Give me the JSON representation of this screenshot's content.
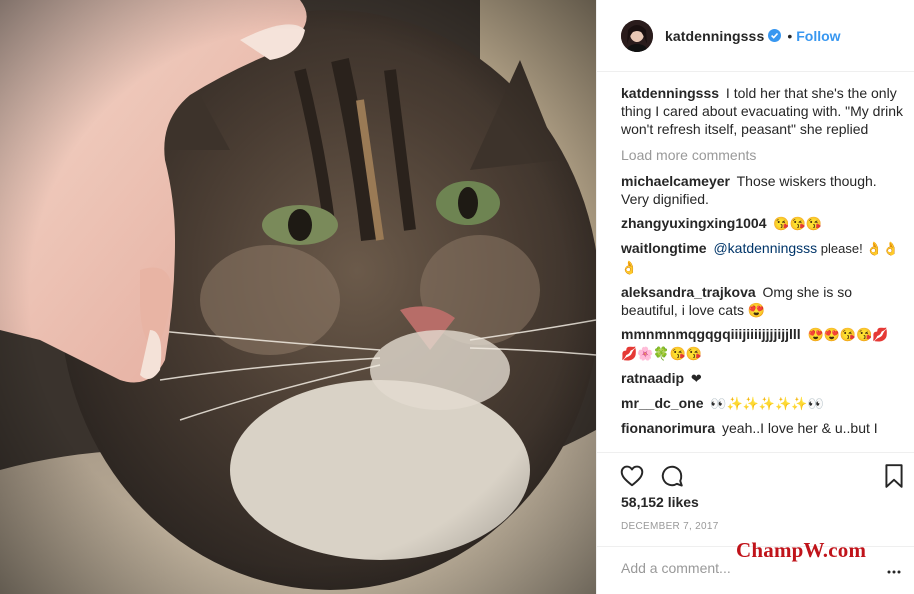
{
  "post": {
    "username": "katdenningsss",
    "follow_label": "Follow",
    "dot": "•",
    "caption_user": "katdenningsss",
    "caption_text": "I told her that she's the only thing I cared about evacuating with. \"My drink won't refresh itself, peasant\" she replied",
    "load_more": "Load more comments",
    "likes": "58,152 likes",
    "date": "December 7, 2017",
    "add_comment_placeholder": "Add a comment...",
    "more_icon": "ellipsis-icon"
  },
  "comments": [
    {
      "user": "michaelcameyer",
      "text": "Those wiskers though. Very dignified."
    },
    {
      "user": "zhangyuxingxing1004",
      "text": "😘😘😘"
    },
    {
      "user": "waitlongtime",
      "mention": "@katdenningsss",
      "text": " please! 👌👌👌"
    },
    {
      "user": "aleksandra_trajkova",
      "text": "Omg she is so beautiful, i love cats 😍"
    },
    {
      "user": "mmnmnmqgqgqiiijiiiijjjjijjlll",
      "text": "😍😍😘😘💋💋🌸🍀😘😘"
    },
    {
      "user": "ratnaadip",
      "text": "❤"
    },
    {
      "user": "mr__dc_one",
      "text": "👀✨✨✨✨✨👀"
    },
    {
      "user": "fionanorimura",
      "text": "yeah..I love her & u..but I"
    }
  ],
  "icons": {
    "heart": "heart-icon",
    "comment": "comment-icon",
    "bookmark": "bookmark-icon",
    "verified": "verified-badge-icon"
  },
  "colors": {
    "link_blue": "#3897f0",
    "watermark_red": "#c0131a",
    "muted_gray": "#999999"
  },
  "watermark": "ChampW.com"
}
